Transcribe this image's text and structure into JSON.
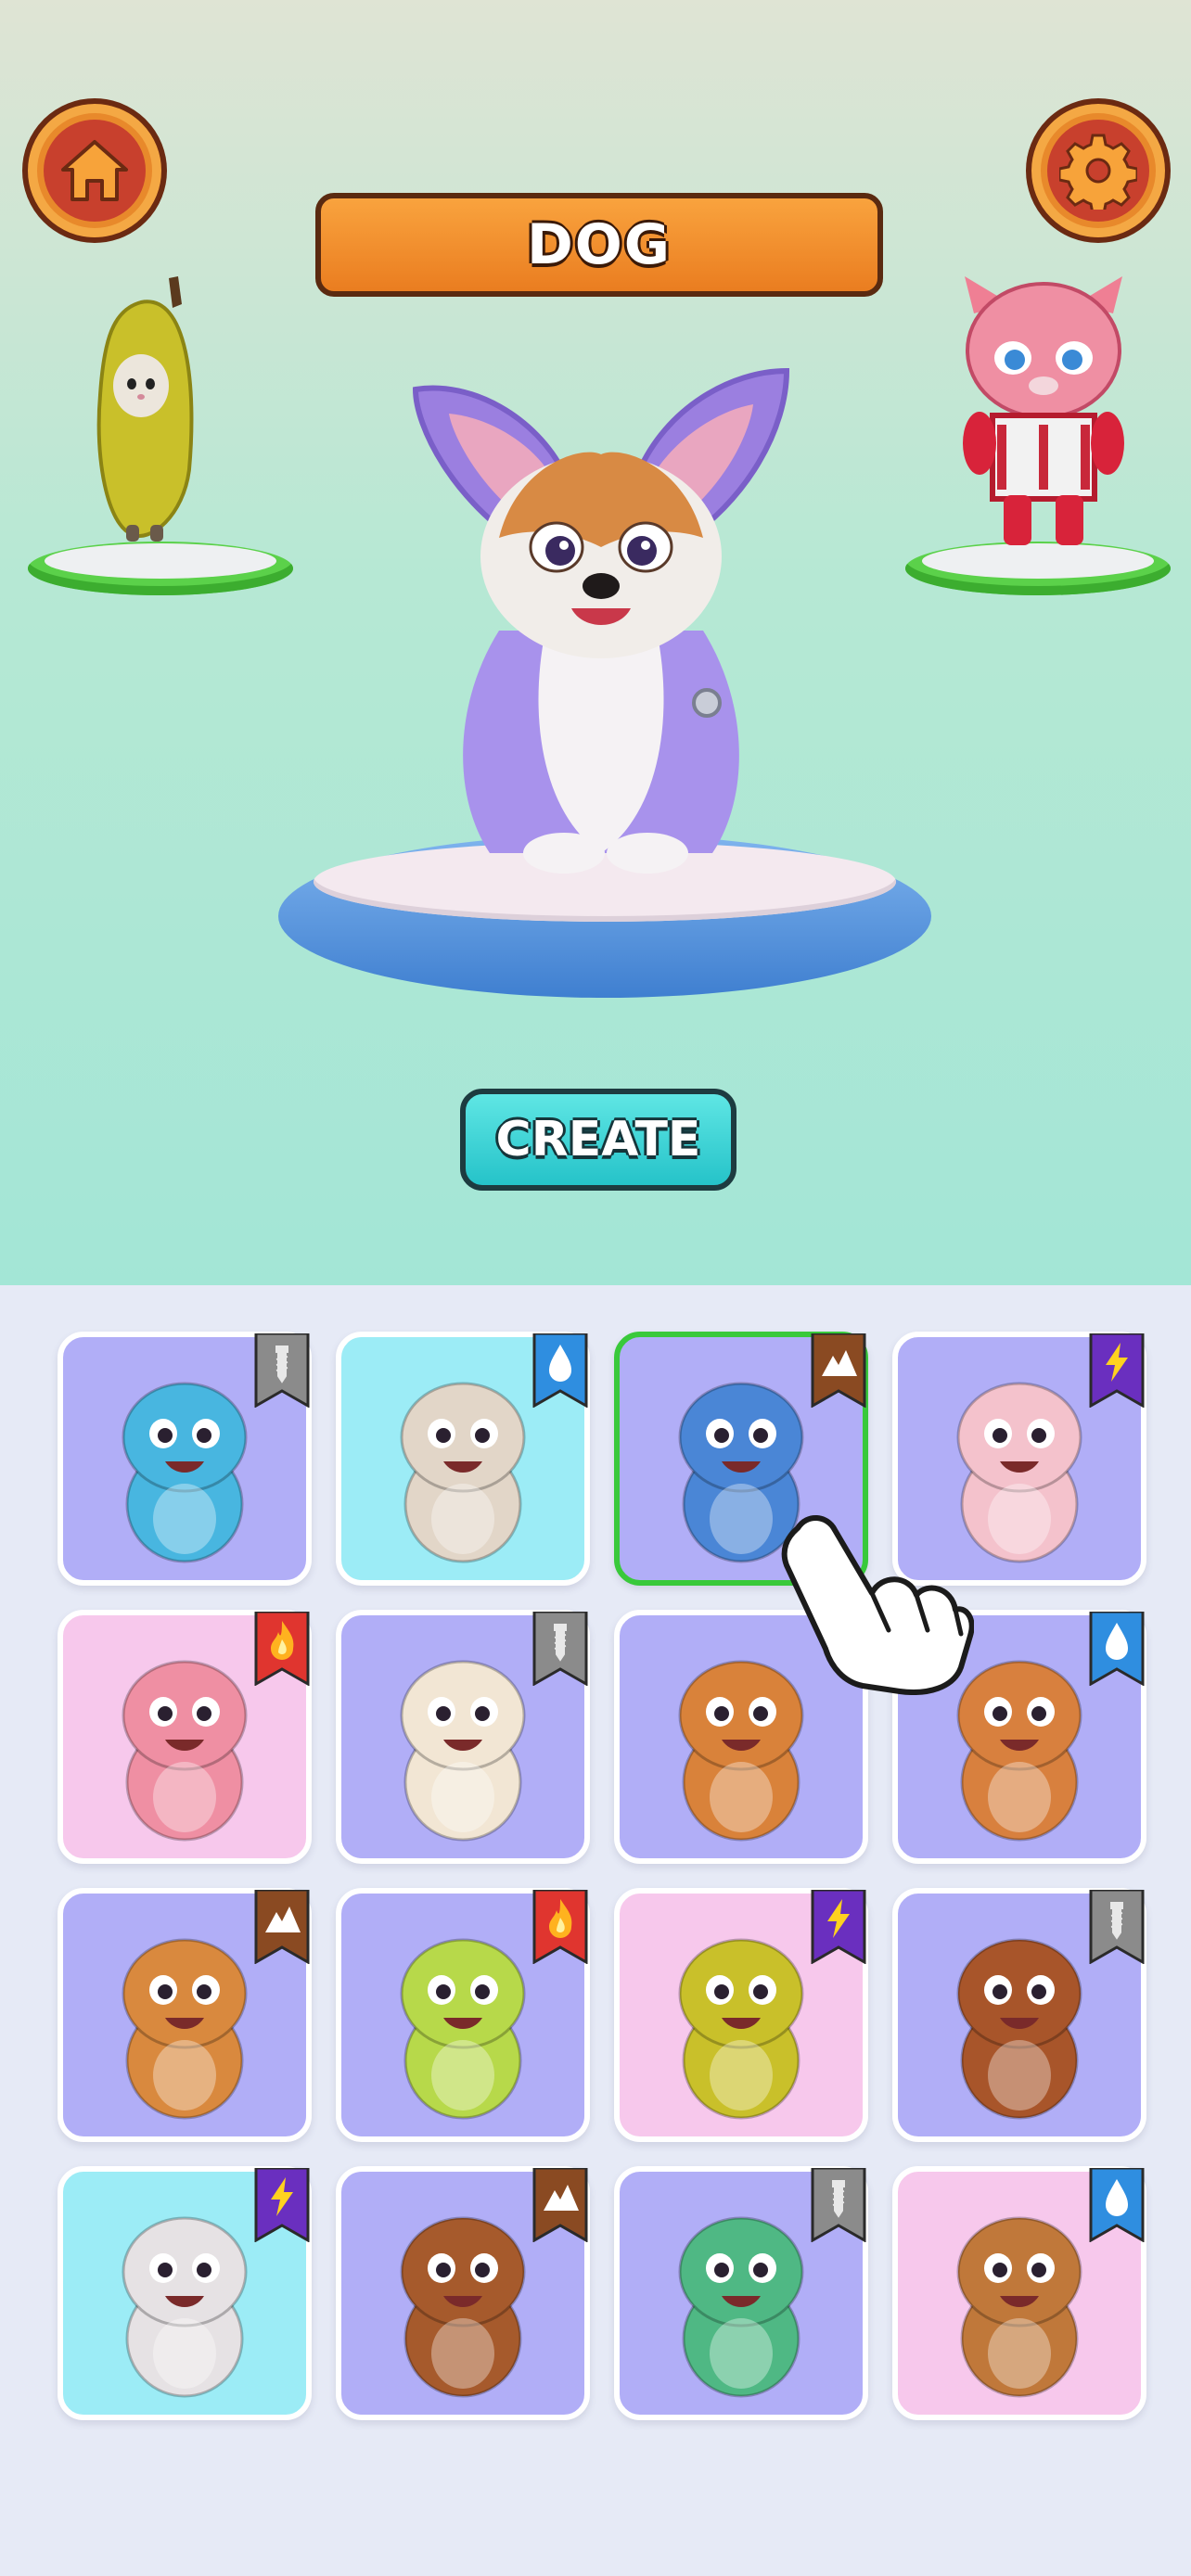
{
  "title": "DOG",
  "buttons": {
    "home": "home-icon",
    "settings": "gear-icon",
    "create_label": "CREATE"
  },
  "side_characters": {
    "left": "banana-cat",
    "right": "pink-tiger-robot"
  },
  "main_character": "dog",
  "colors": {
    "purple_card": "#b1aef7",
    "cyan_card": "#9cecf6",
    "pink_card": "#f7c8ec",
    "badge_gray": "#8b8b8b",
    "badge_blue": "#2f8ee0",
    "badge_brown": "#8a4a22",
    "badge_purple": "#6a2fbf",
    "badge_red": "#e0352f",
    "selected_border": "#39c93b"
  },
  "cards": [
    {
      "creature": "blue-dinosaur",
      "bg": "purple",
      "badge": "metal",
      "badge_icon": "screw-icon"
    },
    {
      "creature": "hamster",
      "bg": "cyan",
      "badge": "water",
      "badge_icon": "water-drop-icon"
    },
    {
      "creature": "shark",
      "bg": "purple",
      "badge": "earth",
      "badge_icon": "mountain-icon",
      "selected": true
    },
    {
      "creature": "pig",
      "bg": "purple",
      "badge": "electric",
      "badge_icon": "lightning-icon"
    },
    {
      "creature": "pink-tiger-robot",
      "bg": "pink",
      "badge": "fire",
      "badge_icon": "flame-icon"
    },
    {
      "creature": "fluffy-cat",
      "bg": "purple",
      "badge": "metal",
      "badge_icon": "screw-icon"
    },
    {
      "creature": "tiger-cub",
      "bg": "purple",
      "badge": "none"
    },
    {
      "creature": "squirrel",
      "bg": "purple",
      "badge": "water",
      "badge_icon": "water-drop-icon"
    },
    {
      "creature": "monkey",
      "bg": "purple",
      "badge": "earth",
      "badge_icon": "mountain-icon"
    },
    {
      "creature": "frog",
      "bg": "purple",
      "badge": "fire",
      "badge_icon": "flame-icon"
    },
    {
      "creature": "banana-cat",
      "bg": "pink",
      "badge": "electric",
      "badge_icon": "lightning-icon"
    },
    {
      "creature": "brown-squirrel",
      "bg": "purple",
      "badge": "metal",
      "badge_icon": "screw-icon"
    },
    {
      "creature": "mouse",
      "bg": "cyan",
      "badge": "electric",
      "badge_icon": "lightning-icon"
    },
    {
      "creature": "brown-dog",
      "bg": "purple",
      "badge": "earth",
      "badge_icon": "mountain-icon"
    },
    {
      "creature": "green-dinosaur",
      "bg": "purple",
      "badge": "metal",
      "badge_icon": "screw-icon"
    },
    {
      "creature": "lion-cub",
      "bg": "pink",
      "badge": "water",
      "badge_icon": "water-drop-icon"
    }
  ]
}
